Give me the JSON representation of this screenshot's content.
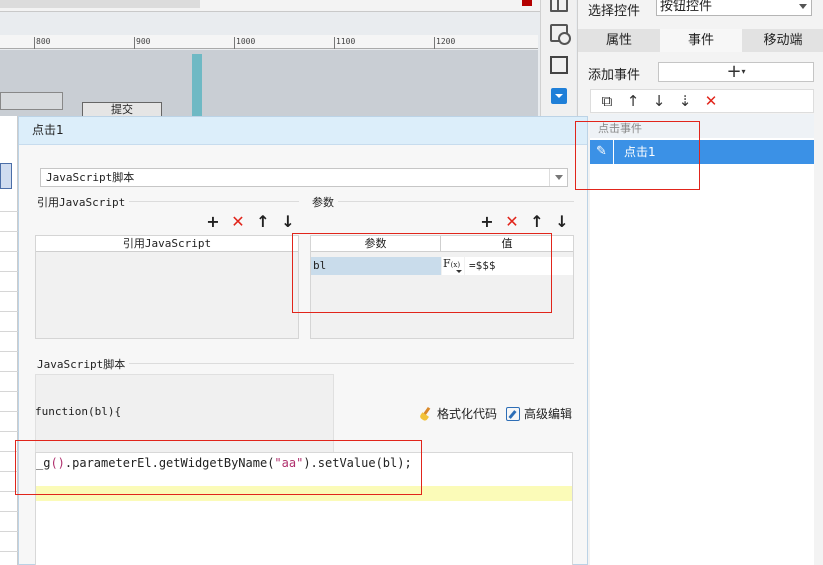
{
  "ruler": {
    "ticks": [
      "800",
      "900",
      "1000",
      "1100",
      "1200"
    ]
  },
  "canvas": {
    "submit_label": "提交"
  },
  "right_panel": {
    "select_label": "选择控件",
    "select_value": "按钮控件",
    "tabs": [
      {
        "label": "属性",
        "active": false
      },
      {
        "label": "事件",
        "active": true
      },
      {
        "label": "移动端",
        "active": false
      }
    ],
    "add_event_label": "添加事件",
    "add_event_symbol": "+",
    "toolbar_icons": [
      "copy-icon",
      "arrow-up-icon",
      "arrow-down-icon",
      "move-down-icon",
      "delete-icon"
    ],
    "event_group": "点击事件",
    "event_item": "点击1"
  },
  "dialog": {
    "title": "点击1",
    "type_select": "JavaScript脚本",
    "ref_js_title": "引用JavaScript",
    "ref_js_column": "引用JavaScript",
    "params_title": "参数",
    "params_columns": [
      "参数",
      "值"
    ],
    "param_rows": [
      {
        "name": "bl",
        "formula": "F(x)",
        "value": "=$$$"
      }
    ],
    "script_title": "JavaScript脚本",
    "function_signature": "function(bl){",
    "format_label": "格式化代码",
    "advanced_label": "高级编辑",
    "code": {
      "prefix": "_g",
      "open_close": "()",
      "middle": ".parameterEl.getWidgetByName(",
      "string": "\"aa\"",
      "after": ").setValue(bl);"
    }
  }
}
